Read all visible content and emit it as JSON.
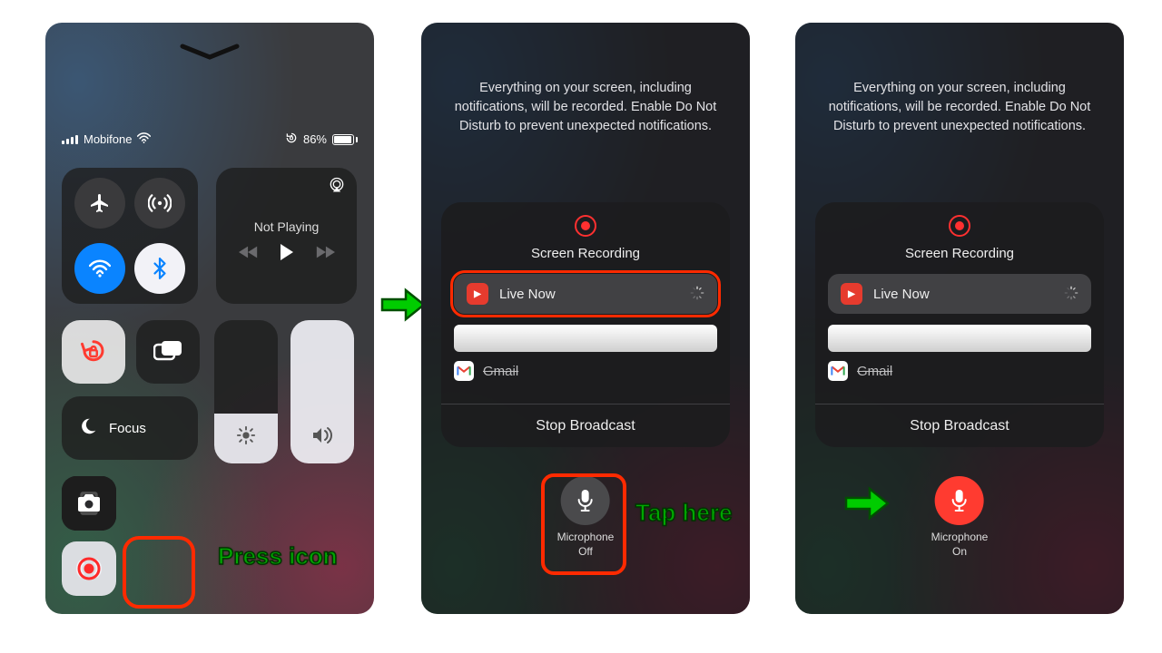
{
  "statusbar": {
    "carrier": "Mobifone",
    "battery_pct": "86%"
  },
  "cc": {
    "not_playing": "Not Playing",
    "focus": "Focus"
  },
  "sheet": {
    "message": "Everything on your screen, including notifications, will be recorded. Enable Do Not Disturb to prevent unexpected notifications.",
    "title": "Screen Recording",
    "app_live": "Live Now",
    "app_gmail": "Gmail",
    "stop": "Stop Broadcast"
  },
  "mic": {
    "label": "Microphone",
    "off": "Off",
    "on": "On"
  },
  "annotations": {
    "press": "Press icon",
    "tap": "Tap here"
  }
}
